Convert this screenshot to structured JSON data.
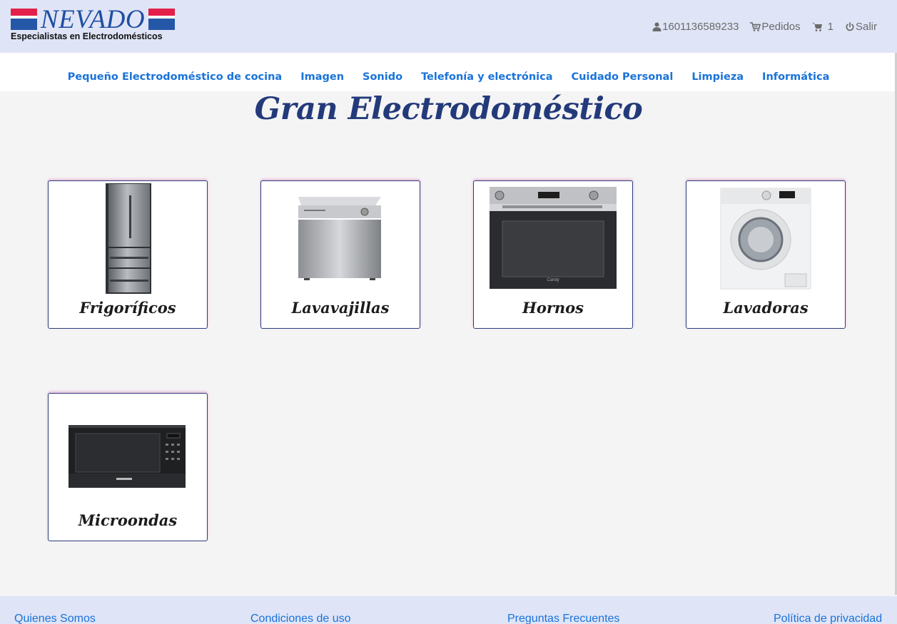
{
  "brand": {
    "name": "NEVADO",
    "tagline": "Especialistas en Electrodomésticos"
  },
  "usernav": {
    "user_id": "1601136589233",
    "orders_label": "Pedidos",
    "cart_count": "1",
    "logout_label": "Salir"
  },
  "categories": [
    "Pequeño Electrodoméstico de cocina",
    "Imagen",
    "Sonido",
    "Telefonía y electrónica",
    "Cuidado Personal",
    "Limpieza",
    "Informática"
  ],
  "page": {
    "title": "Gran Electrodoméstico"
  },
  "products": [
    {
      "label": "Frigoríficos",
      "icon": "fridge-image"
    },
    {
      "label": "Lavavajillas",
      "icon": "dishwasher-image"
    },
    {
      "label": "Hornos",
      "icon": "oven-image"
    },
    {
      "label": "Lavadoras",
      "icon": "washing-machine-image"
    },
    {
      "label": "Microondas",
      "icon": "microwave-image"
    }
  ],
  "footer": {
    "links": [
      "Quienes Somos",
      "Condiciones de uso",
      "Preguntas Frecuentes",
      "Política de privacidad"
    ]
  },
  "colors": {
    "header_bg": "#dfe4f6",
    "link_blue": "#1a73d9",
    "title_navy": "#233a7a",
    "card_border": "#2b3d7d",
    "brand_red": "#e3204a",
    "brand_blue": "#2557a7"
  }
}
